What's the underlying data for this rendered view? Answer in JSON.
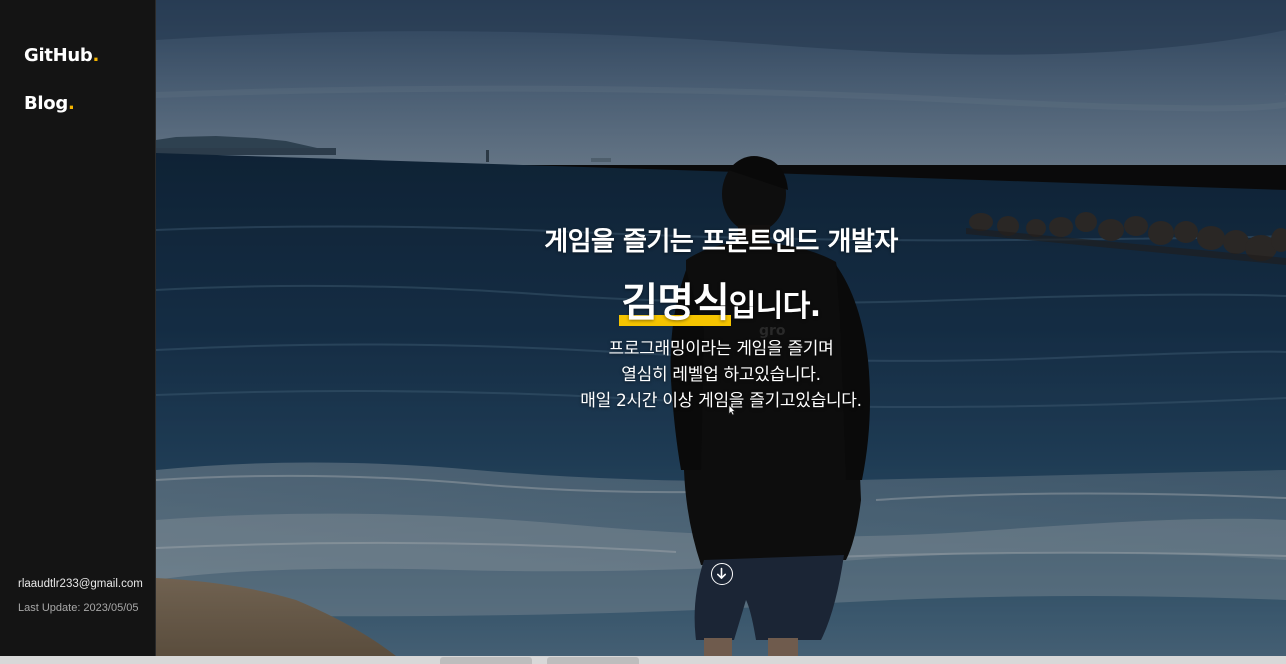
{
  "sidebar": {
    "nav": [
      {
        "label": "GitHub",
        "dot": "."
      },
      {
        "label": "Blog",
        "dot": "."
      }
    ],
    "email": "rlaaudtlr233@gmail.com",
    "last_update": "Last Update: 2023/05/05"
  },
  "hero": {
    "headline": "게임을 즐기는 프론트엔드 개발자",
    "name": "김명식",
    "name_suffix": "입니다.",
    "intro_lines": [
      "프로그래밍이라는 게임을 즐기며",
      "열심히 레벨업 하고있습니다.",
      "매일 2시간 이상 게임을 즐기고있습니다."
    ],
    "scroll_icon": "arrow-down-circle-icon"
  },
  "colors": {
    "accent": "#f5c400",
    "sidebar_bg": "#141414",
    "text": "#ffffff"
  }
}
